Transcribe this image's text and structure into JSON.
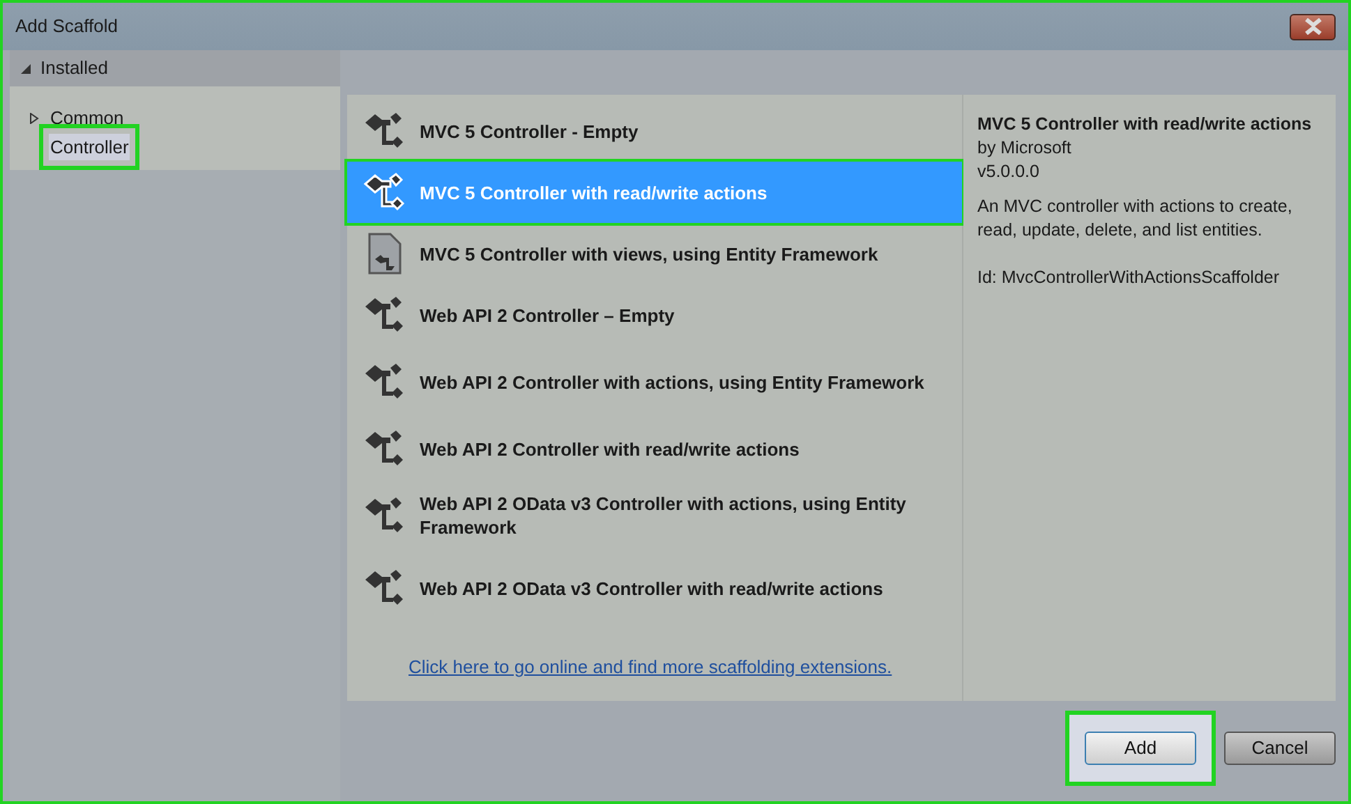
{
  "window": {
    "title": "Add Scaffold",
    "highlighted": true
  },
  "tree": {
    "header": "Installed",
    "expanded": true,
    "items": [
      {
        "label": "Common",
        "expanded": false,
        "selected": false,
        "highlighted": false
      },
      {
        "label": "Controller",
        "selected": true,
        "highlighted": true
      }
    ]
  },
  "scaffolds": [
    {
      "label": "MVC 5 Controller - Empty",
      "kind": "controller",
      "selected": false,
      "highlighted": false
    },
    {
      "label": "MVC 5 Controller with read/write actions",
      "kind": "controller",
      "selected": true,
      "highlighted": true
    },
    {
      "label": "MVC 5 Controller with views, using Entity Framework",
      "kind": "document",
      "selected": false,
      "highlighted": false
    },
    {
      "label": "Web API 2 Controller – Empty",
      "kind": "controller",
      "selected": false,
      "highlighted": false
    },
    {
      "label": "Web API 2 Controller with actions, using Entity Framework",
      "kind": "controller",
      "selected": false,
      "highlighted": false
    },
    {
      "label": "Web API 2 Controller with read/write actions",
      "kind": "controller",
      "selected": false,
      "highlighted": false
    },
    {
      "label": "Web API 2 OData v3 Controller with actions, using Entity Framework",
      "kind": "controller",
      "selected": false,
      "highlighted": false
    },
    {
      "label": "Web API 2 OData v3 Controller with read/write actions",
      "kind": "controller",
      "selected": false,
      "highlighted": false
    }
  ],
  "online_link": "Click here to go online and find more scaffolding extensions.",
  "details": {
    "title": "MVC 5 Controller with read/write actions",
    "author": "by Microsoft",
    "version": "v5.0.0.0",
    "description": "An MVC controller with actions to create, read, update, delete, and list entities.",
    "id": "Id: MvcControllerWithActionsScaffolder"
  },
  "buttons": [
    {
      "label": "Add",
      "kind": "primary",
      "highlighted": true
    },
    {
      "label": "Cancel",
      "kind": "normal",
      "highlighted": false
    }
  ]
}
